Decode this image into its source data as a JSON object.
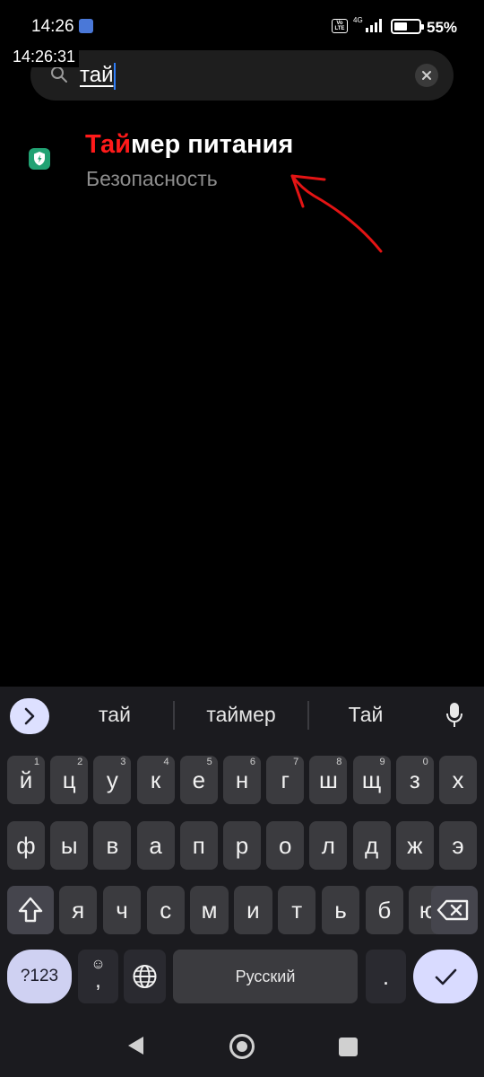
{
  "status_bar": {
    "time": "14:26",
    "network": "4G",
    "volte": "Vo LTE",
    "battery_percent_text": "55%",
    "battery_level": 0.55
  },
  "clock_overlay": "14:26:31",
  "search": {
    "query": "тай"
  },
  "result": {
    "title_match": "Тай",
    "title_rest": "мер питания",
    "subtitle": "Безопасность",
    "highlight_color": "#ff1a1a",
    "icon": "shield-lightning-icon"
  },
  "keyboard": {
    "suggestions": [
      "тай",
      "таймер",
      "Тай"
    ],
    "row1": [
      {
        "key": "й",
        "hint": "1"
      },
      {
        "key": "ц",
        "hint": "2"
      },
      {
        "key": "у",
        "hint": "3"
      },
      {
        "key": "к",
        "hint": "4"
      },
      {
        "key": "е",
        "hint": "5"
      },
      {
        "key": "н",
        "hint": "6"
      },
      {
        "key": "г",
        "hint": "7"
      },
      {
        "key": "ш",
        "hint": "8"
      },
      {
        "key": "щ",
        "hint": "9"
      },
      {
        "key": "з",
        "hint": "0"
      },
      {
        "key": "х",
        "hint": ""
      }
    ],
    "row2": [
      "ф",
      "ы",
      "в",
      "а",
      "п",
      "р",
      "о",
      "л",
      "д",
      "ж",
      "э"
    ],
    "row3": [
      "я",
      "ч",
      "с",
      "м",
      "и",
      "т",
      "ь",
      "б",
      "ю"
    ],
    "symbols_label": "?123",
    "emoji_label": "☺",
    "comma_label": ",",
    "space_label": "Русский",
    "period_label": ".",
    "enter_label": "✓"
  },
  "colors": {
    "keyboard_bg": "#1b1b1f",
    "key_bg": "#3b3b3f",
    "accent": "#d9dbff",
    "caret": "#2f7df6"
  }
}
